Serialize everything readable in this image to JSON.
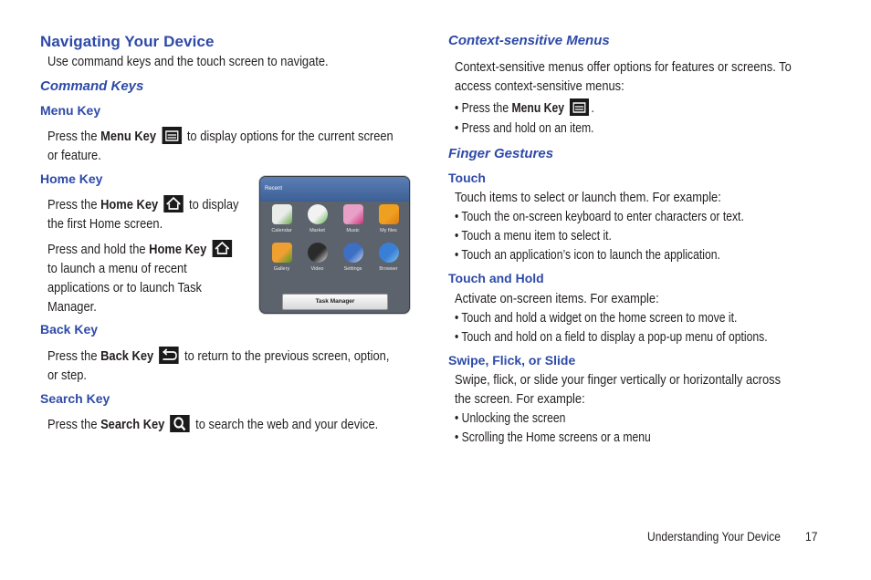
{
  "left": {
    "title": "Navigating Your Device",
    "intro": "Use command keys and the touch screen to navigate.",
    "section": "Command Keys",
    "menu_key": {
      "heading": "Menu Key",
      "pre": "Press the ",
      "key": "Menu Key",
      "post": " to display options for the current screen",
      "line2": "or feature.",
      "icon": "menu-icon"
    },
    "home_key": {
      "heading": "Home Key",
      "p1_pre": "Press the ",
      "p1_key": "Home Key",
      "p1_post": " to display",
      "p1_line2": "the first Home screen.",
      "p2_pre": "Press and hold the ",
      "p2_key": "Home Key",
      "p2_line2": "to launch a menu of recent",
      "p2_line3": "applications or to launch Task",
      "p2_line4": "Manager.",
      "icon": "home-icon"
    },
    "back_key": {
      "heading": "Back Key",
      "pre": "Press the ",
      "key": "Back Key",
      "post": " to return to the previous screen, option,",
      "line2": "or step.",
      "icon": "back-icon"
    },
    "search_key": {
      "heading": "Search Key",
      "pre": "Press the ",
      "key": "Search Key",
      "post": " to search the web and your device.",
      "icon": "search-icon"
    }
  },
  "phone": {
    "bar_title": "Recent",
    "apps": [
      {
        "label": "Calendar",
        "color": "#e9ece8",
        "accent": "#6aa84f"
      },
      {
        "label": "Market",
        "color": "#f2f2f2",
        "accent": "#5fb34a"
      },
      {
        "label": "Music",
        "color": "#e8a0c8",
        "accent": "#d0307a"
      },
      {
        "label": "My files",
        "color": "#f0a020",
        "accent": "#e07b10"
      },
      {
        "label": "Gallery",
        "color": "#f0a030",
        "accent": "#4c9a2a"
      },
      {
        "label": "Video",
        "color": "#2b2b2b",
        "accent": "#e8e8e8"
      },
      {
        "label": "Settings",
        "color": "#3d6fc4",
        "accent": "#c8d8f0"
      },
      {
        "label": "Browser",
        "color": "#3a7fd6",
        "accent": "#7fc0f0"
      }
    ],
    "task_manager": "Task Manager"
  },
  "right": {
    "context": {
      "heading": "Context-sensitive Menus",
      "line1": "Context-sensitive menus offer options for features or screens. To",
      "line2": "access context-sensitive menus:",
      "b1_pre": "• Press the ",
      "b1_key": "Menu Key",
      "b1_post": ".",
      "b2": "• Press and hold on an item."
    },
    "gestures": {
      "heading": "Finger Gestures",
      "touch": {
        "heading": "Touch",
        "intro": "Touch items to select or launch them. For example:",
        "bullets": [
          "• Touch the on-screen keyboard to enter characters or text.",
          "• Touch a menu item to select it.",
          "• Touch an application’s icon to launch the application."
        ]
      },
      "touch_hold": {
        "heading": "Touch and Hold",
        "intro": "Activate on-screen items. For example:",
        "bullets": [
          "• Touch and hold a widget on the home screen to move it.",
          "• Touch and hold on a field to display a pop-up menu of options."
        ]
      },
      "swipe": {
        "heading": "Swipe, Flick, or Slide",
        "line1": "Swipe, flick, or slide your finger vertically or horizontally across",
        "line2": "the screen. For example:",
        "bullets": [
          "• Unlocking the screen",
          "• Scrolling the Home screens or a menu"
        ]
      }
    }
  },
  "footer": {
    "section": "Understanding Your Device",
    "page": "17"
  }
}
